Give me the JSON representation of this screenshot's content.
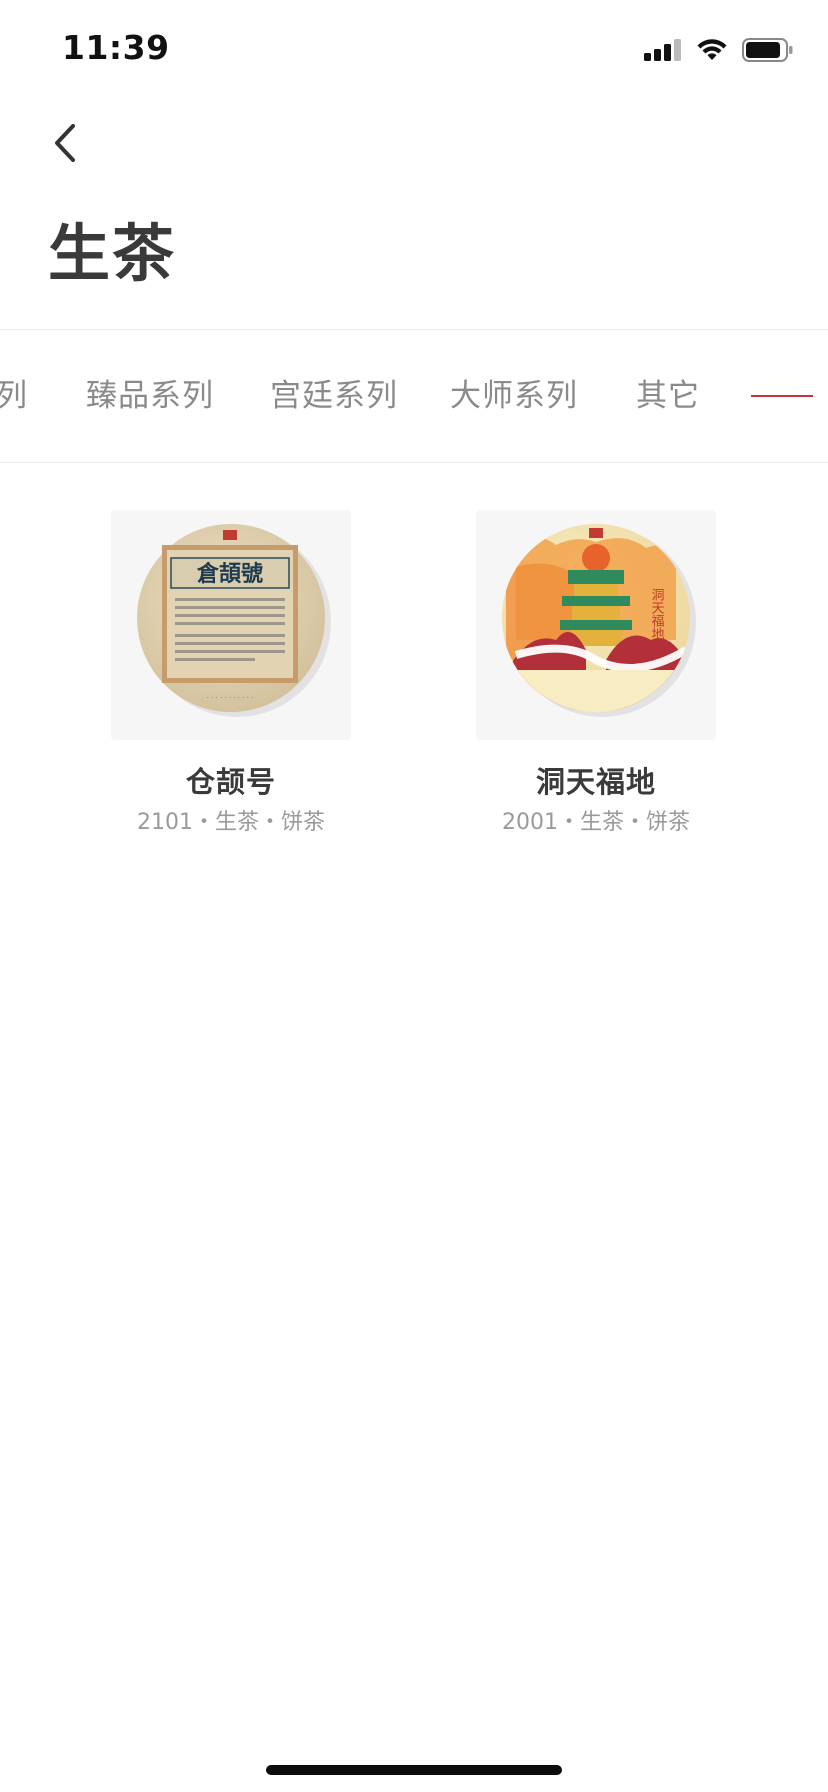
{
  "status_bar": {
    "time": "11:39"
  },
  "header": {
    "back_icon": "chevron-left-icon",
    "title": "生茶"
  },
  "tabs": [
    {
      "label": "列"
    },
    {
      "label": "臻品系列"
    },
    {
      "label": "宫廷系列"
    },
    {
      "label": "大师系列"
    },
    {
      "label": "其它"
    }
  ],
  "accent_color": "#c9333a",
  "products": [
    {
      "name": "仓颉号",
      "meta": "2101・生茶・饼茶",
      "cake_text": "倉頡號"
    },
    {
      "name": "洞天福地",
      "meta": "2001・生茶・饼茶",
      "cake_text": "洞天福地"
    }
  ]
}
